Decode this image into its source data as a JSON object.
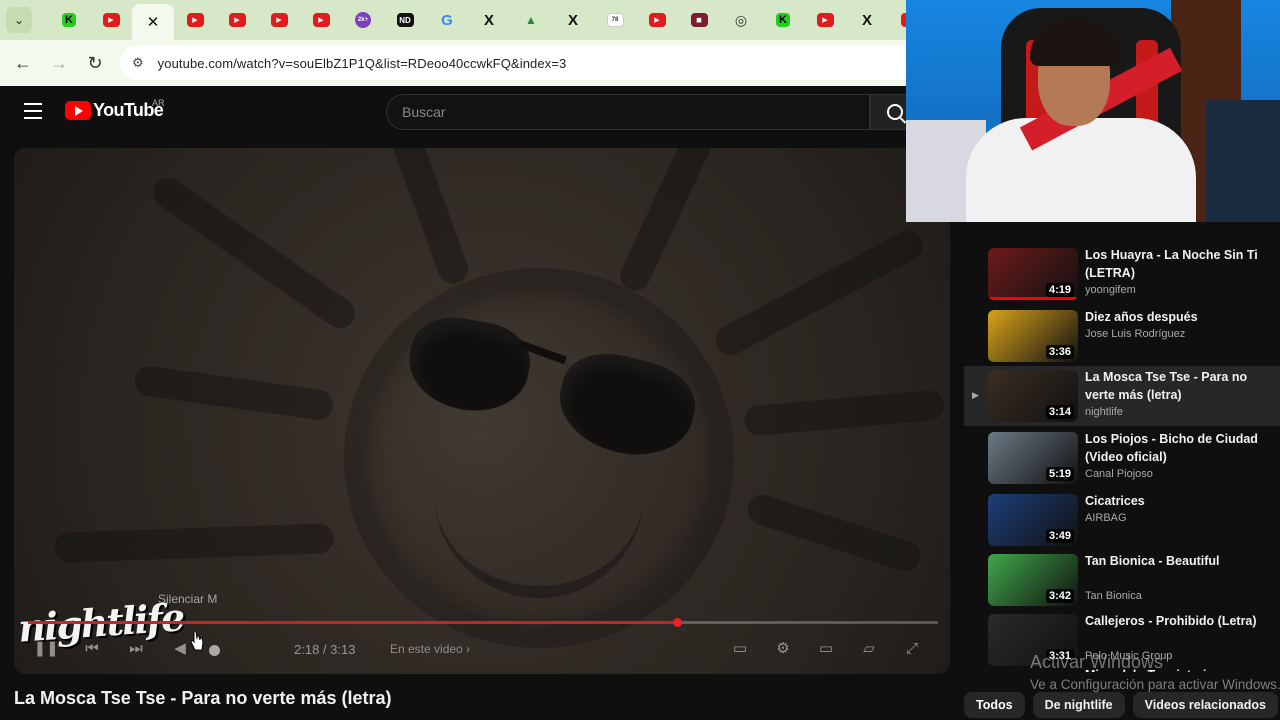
{
  "browser": {
    "tabs": [
      {
        "icon": "chevron-down-icon"
      },
      {
        "icon": "kick-icon",
        "glyph": "K"
      },
      {
        "icon": "youtube-icon",
        "glyph": "▶"
      },
      {
        "icon": "close-icon",
        "glyph": "✕",
        "active": true
      },
      {
        "icon": "youtube-icon",
        "glyph": "▶"
      },
      {
        "icon": "youtube-icon",
        "glyph": "▶"
      },
      {
        "icon": "youtube-icon",
        "glyph": "▶"
      },
      {
        "icon": "youtube-icon",
        "glyph": "▶"
      },
      {
        "icon": "2k-icon",
        "glyph": "2k+"
      },
      {
        "icon": "nd-icon",
        "glyph": "ND"
      },
      {
        "icon": "google-icon",
        "glyph": "G"
      },
      {
        "icon": "x-icon",
        "glyph": "X"
      },
      {
        "icon": "drive-icon",
        "glyph": "▲"
      },
      {
        "icon": "x-icon",
        "glyph": "X"
      },
      {
        "icon": "site-icon",
        "glyph": "78"
      },
      {
        "icon": "youtube-icon",
        "glyph": "▶"
      },
      {
        "icon": "maroon-icon",
        "glyph": "◼"
      },
      {
        "icon": "circle-icon",
        "glyph": "◎"
      },
      {
        "icon": "kick-icon",
        "glyph": "K"
      },
      {
        "icon": "youtube-icon",
        "glyph": "▶"
      },
      {
        "icon": "x-icon",
        "glyph": "X"
      },
      {
        "icon": "youtube-icon",
        "glyph": "▶"
      }
    ],
    "url": "youtube.com/watch?v=souElbZ1P1Q&list=RDeoo40ccwkFQ&index=3"
  },
  "youtube": {
    "logo_text": "YouTube",
    "country": "AR",
    "search_placeholder": "Buscar"
  },
  "player": {
    "watermark": "nightlife",
    "mute_tooltip": "Silenciar  M",
    "time": "2:18 / 3:13",
    "chapters": "En este video  ›",
    "progress": 0.713
  },
  "video_title": "La Mosca Tse Tse - Para no verte más (letra)",
  "playlist": [
    {
      "title": "Los Huayra - La Noche Sin Ti (LETRA)",
      "channel": "yoongifem",
      "duration": "4:19",
      "watched": 1.0,
      "thumb": "#6e1a1a"
    },
    {
      "title": "Diez años después",
      "channel": "Jose Luis Rodríguez",
      "duration": "3:36",
      "watched": 0.0,
      "thumb": "#d9a21a"
    },
    {
      "title": "La Mosca Tse Tse - Para no verte más (letra)",
      "channel": "nightlife",
      "duration": "3:14",
      "watched": 0.0,
      "current": true,
      "thumb": "#3a2e24"
    },
    {
      "title": "Los Piojos - Bicho de Ciudad (Video oficial)",
      "channel": "Canal Piojoso",
      "duration": "5:19",
      "watched": 0.0,
      "thumb": "#6b7a86"
    },
    {
      "title": "Cicatrices",
      "channel": "AIRBAG",
      "duration": "3:49",
      "watched": 0.0,
      "thumb": "#1d3f7a"
    },
    {
      "title": "Tan Bionica - Beautiful",
      "channel": "Tan Bionica",
      "duration": "3:42",
      "watched": 0.0,
      "thumb": "#3fa84a"
    },
    {
      "title": "Callejeros - Prohibido (Letra)",
      "channel": "Pelo Music Group",
      "duration": "3:31",
      "watched": 0.0,
      "thumb": "#2a2a2a"
    }
  ],
  "next_partial": "Mirandal - Tu misterioso",
  "windows_activation": {
    "line1": "Activar Windows",
    "line2": "Ve a Configuración para activar Windows."
  },
  "chips": [
    "Todos",
    "De nightlife",
    "Videos relacionados"
  ]
}
